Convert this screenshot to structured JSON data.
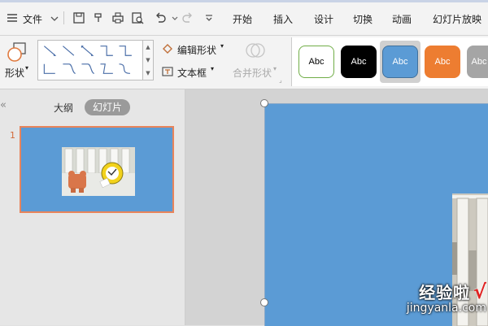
{
  "menubar": {
    "file_label": "文件",
    "tabs": [
      "开始",
      "插入",
      "设计",
      "切换",
      "动画",
      "幻灯片放映"
    ]
  },
  "ribbon": {
    "shape_label": "形状",
    "edit_shape_label": "编辑形状",
    "textbox_label": "文本框",
    "merge_shape_label": "合并形状",
    "style_swatches": [
      {
        "label": "Abc",
        "bg": "#ffffff",
        "fg": "#000000",
        "border": "#70ad47"
      },
      {
        "label": "Abc",
        "bg": "#000000",
        "fg": "#ffffff",
        "border": "#000000"
      },
      {
        "label": "Abc",
        "bg": "#5b9bd5",
        "fg": "#ffffff",
        "border": "#41719c"
      },
      {
        "label": "Abc",
        "bg": "#ed7d31",
        "fg": "#ffffff",
        "border": "#ed7d31"
      },
      {
        "label": "Abc",
        "bg": "#a5a5a5",
        "fg": "#ffffff",
        "border": "#a5a5a5"
      }
    ]
  },
  "leftpane": {
    "collapse_glyph": "«",
    "outline_tab": "大纲",
    "slides_tab": "幻灯片",
    "slide_number": "1"
  },
  "watermark": {
    "title": "经验啦",
    "check": "√",
    "url": "jingyanla.com"
  },
  "colors": {
    "accent": "#5b9bd5",
    "selection": "#e8845b"
  }
}
